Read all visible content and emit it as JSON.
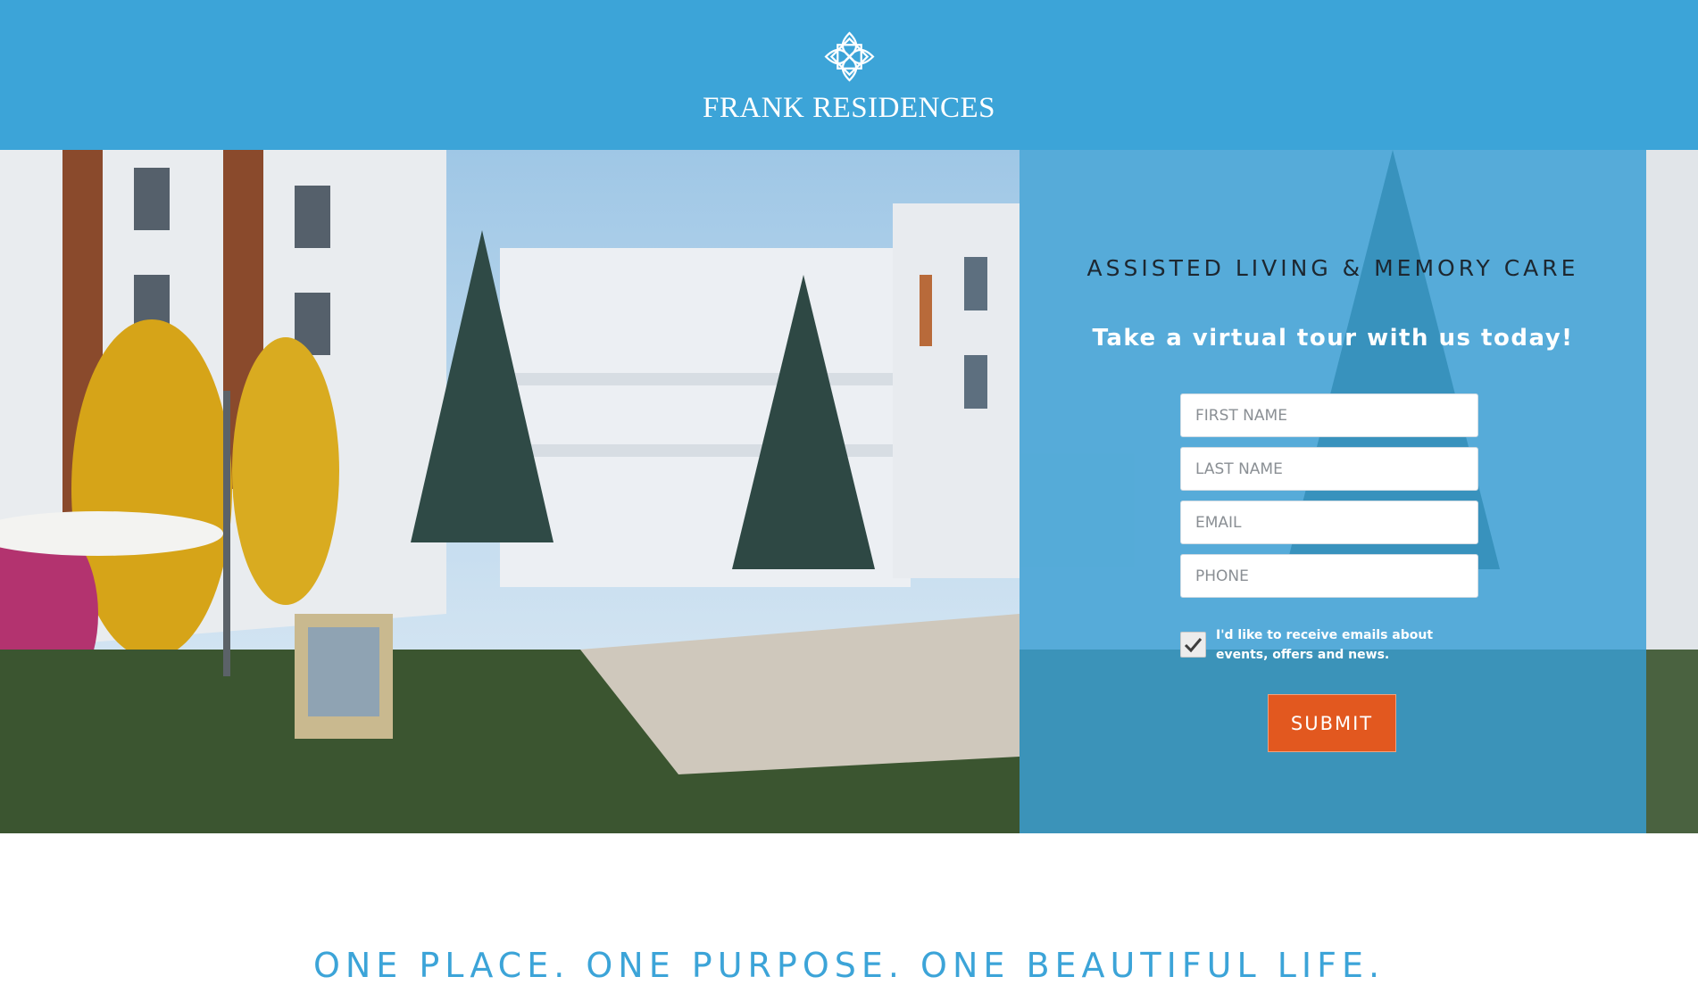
{
  "brand": {
    "name": "FRANK RESIDENCES",
    "logo_icon": "flower-logo-icon",
    "header_color": "#3ca4d8"
  },
  "hero": {
    "image": "courtyard-rendering-image"
  },
  "form": {
    "heading": "ASSISTED LIVING & MEMORY CARE",
    "subheading": "Take a virtual tour with us today!",
    "first_name_placeholder": "FIRST NAME",
    "last_name_placeholder": "LAST NAME",
    "email_placeholder": "EMAIL",
    "phone_placeholder": "PHONE",
    "consent_label": "I'd like to receive emails about events, offers and news.",
    "consent_checked": true,
    "submit_label": "SUBMIT",
    "submit_color": "#e2581f"
  },
  "tagline": "ONE PLACE. ONE PURPOSE. ONE BEAUTIFUL LIFE."
}
